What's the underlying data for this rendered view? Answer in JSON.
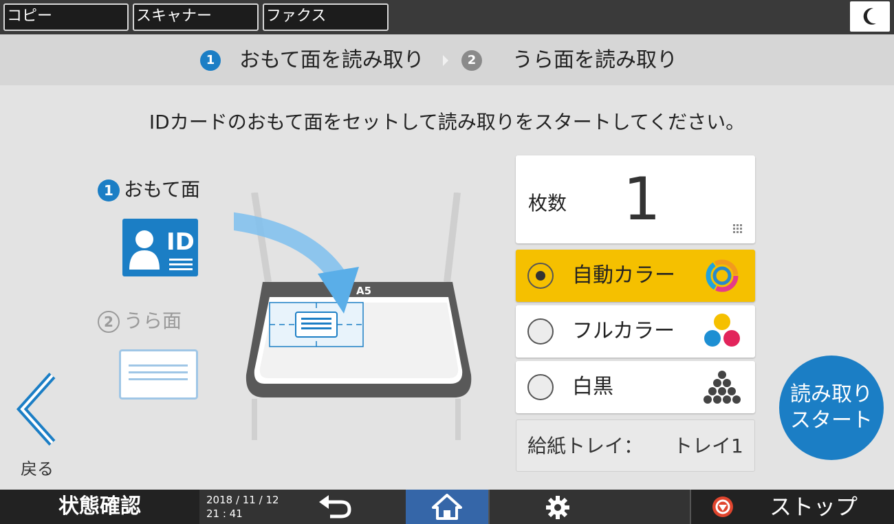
{
  "tabs": [
    {
      "label": "コピー"
    },
    {
      "label": "スキャナー"
    },
    {
      "label": "ファクス"
    }
  ],
  "steps": {
    "step1": {
      "num": "1",
      "label": "おもて面を読み取り"
    },
    "step2": {
      "num": "2",
      "label": "うら面を読み取り"
    }
  },
  "instruction": "IDカードのおもて面をセットして読み取りをスタートしてください。",
  "side": {
    "front": {
      "num": "1",
      "label": "おもて面"
    },
    "back": {
      "num": "2",
      "label": "うら面"
    },
    "id_text": "ID"
  },
  "scanner": {
    "paper_size": "A5"
  },
  "quantity": {
    "label": "枚数",
    "value": "1"
  },
  "color_modes": [
    {
      "label": "自動カラー",
      "selected": true
    },
    {
      "label": "フルカラー",
      "selected": false
    },
    {
      "label": "白黒",
      "selected": false
    }
  ],
  "tray": {
    "label": "給紙トレイ：",
    "value": "トレイ1"
  },
  "start_button": {
    "line1": "読み取り",
    "line2": "スタート"
  },
  "back_button": {
    "label": "戻る"
  },
  "bottom": {
    "status_label": "状態確認",
    "date": "2018 / 11 / 12",
    "time": "21 : 41",
    "stop_label": "ストップ"
  },
  "colors": {
    "accent_blue": "#1b7ec5",
    "selected_yellow": "#f5c000",
    "home_blue": "#3566a8",
    "stop_red": "#e0452e"
  },
  "icons": [
    "moon-icon",
    "undo-arrow-icon",
    "home-icon",
    "gear-icon",
    "stop-icon",
    "back-chevron-icon",
    "keypad-icon"
  ]
}
